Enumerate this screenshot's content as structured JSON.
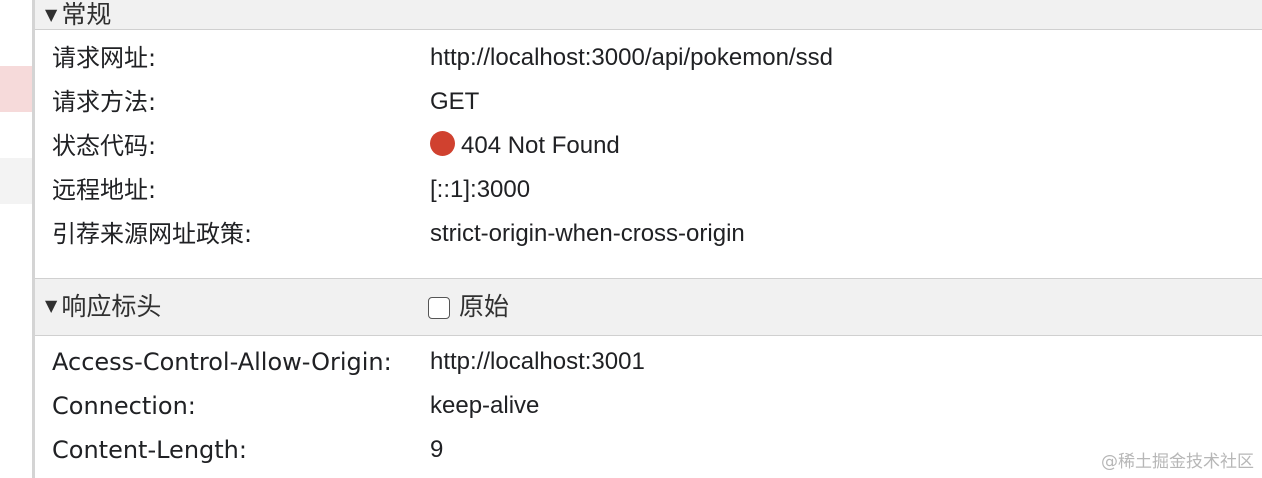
{
  "general": {
    "title": "常规",
    "rows": [
      {
        "key": "请求网址:",
        "value": "http://localhost:3000/api/pokemon/ssd"
      },
      {
        "key": "请求方法:",
        "value": "GET"
      },
      {
        "key": "状态代码:",
        "value": "404 Not Found"
      },
      {
        "key": "远程地址:",
        "value": "[::1]:3000"
      },
      {
        "key": "引荐来源网址政策:",
        "value": "strict-origin-when-cross-origin"
      }
    ],
    "status_color": "#d0412f"
  },
  "response_headers": {
    "title": "响应标头",
    "raw_label": "原始",
    "raw_checked": false,
    "rows": [
      {
        "key": "Access-Control-Allow-Origin:",
        "value": "http://localhost:3001"
      },
      {
        "key": "Connection:",
        "value": "keep-alive"
      },
      {
        "key": "Content-Length:",
        "value": "9"
      }
    ]
  },
  "watermark": "@稀土掘金技术社区",
  "colors": {
    "header_bg": "#f1f1f1",
    "selected_row_bg": "#f6dada",
    "border": "#d0d0d0"
  },
  "icons": {
    "collapse": "triangle-down-icon",
    "status": "status-dot-icon"
  }
}
